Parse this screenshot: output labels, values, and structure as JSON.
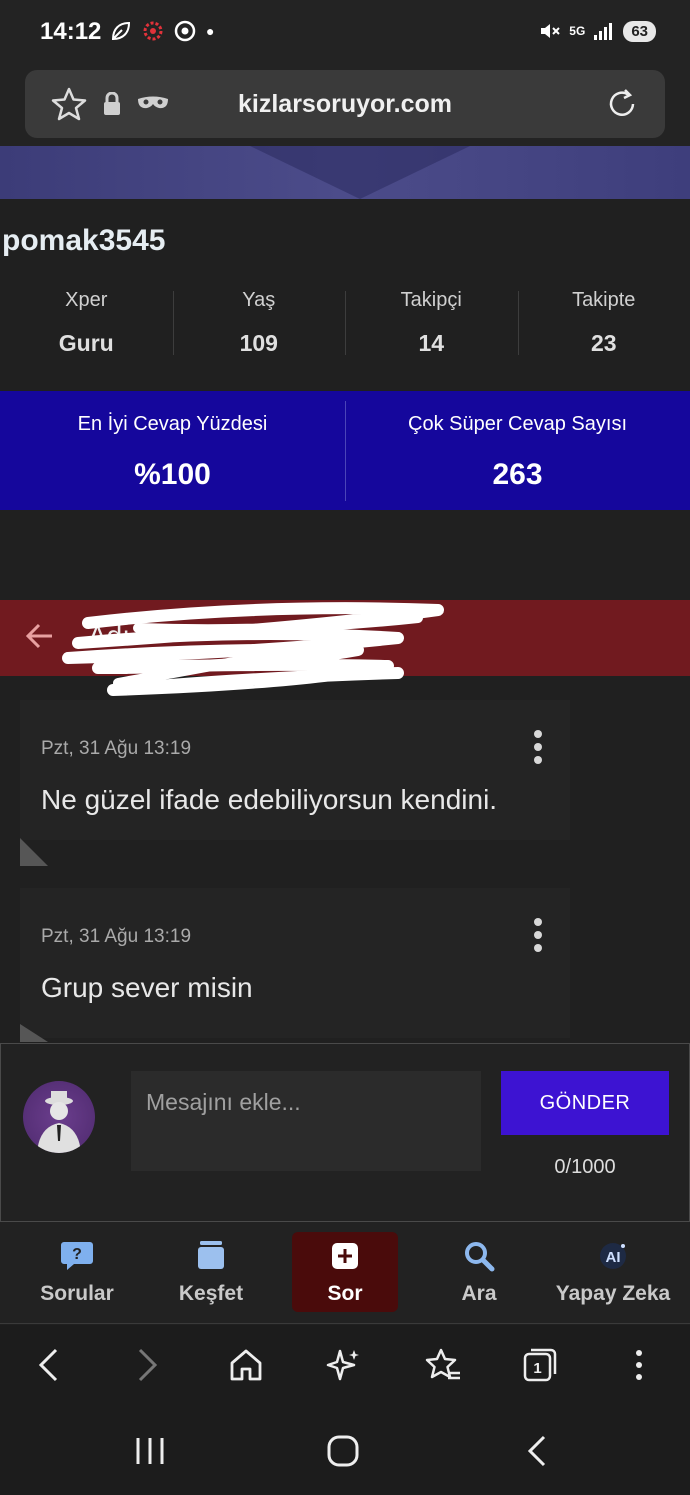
{
  "status_bar": {
    "time": "14:12",
    "battery": "63",
    "network": "5G"
  },
  "browser": {
    "url": "kizlarsoruyor.com"
  },
  "profile": {
    "username": "pomak3545",
    "stats": [
      {
        "label": "Xper",
        "value": "Guru"
      },
      {
        "label": "Yaş",
        "value": "109"
      },
      {
        "label": "Takipçi",
        "value": "14"
      },
      {
        "label": "Takipte",
        "value": "23"
      }
    ],
    "highlights": [
      {
        "label": "En İyi Cevap Yüzdesi",
        "value": "%100"
      },
      {
        "label": "Çok Süper Cevap Sayısı",
        "value": "263"
      }
    ]
  },
  "chat": {
    "contact_name": "Adı",
    "messages": [
      {
        "date": "Pzt, 31 Ağu 13:19",
        "text": "Ne güzel ifade edebiliyorsun kendini."
      },
      {
        "date": "Pzt, 31 Ağu 13:19",
        "text": "Grup sever misin"
      }
    ],
    "compose": {
      "placeholder": "Mesajını ekle...",
      "send_label": "GÖNDER",
      "counter": "0/1000"
    }
  },
  "app_nav": {
    "items": [
      {
        "label": "Sorular",
        "icon": "question-bubble-icon"
      },
      {
        "label": "Keşfet",
        "icon": "cards-icon"
      },
      {
        "label": "Sor",
        "icon": "plus-icon"
      },
      {
        "label": "Ara",
        "icon": "search-icon"
      },
      {
        "label": "Yapay Zeka",
        "icon": "ai-icon"
      }
    ]
  },
  "colors": {
    "blue_panel": "#15079c",
    "chat_header": "#711a1f",
    "send_button": "#3d13d2",
    "sor_highlight": "#4a0b0b"
  }
}
